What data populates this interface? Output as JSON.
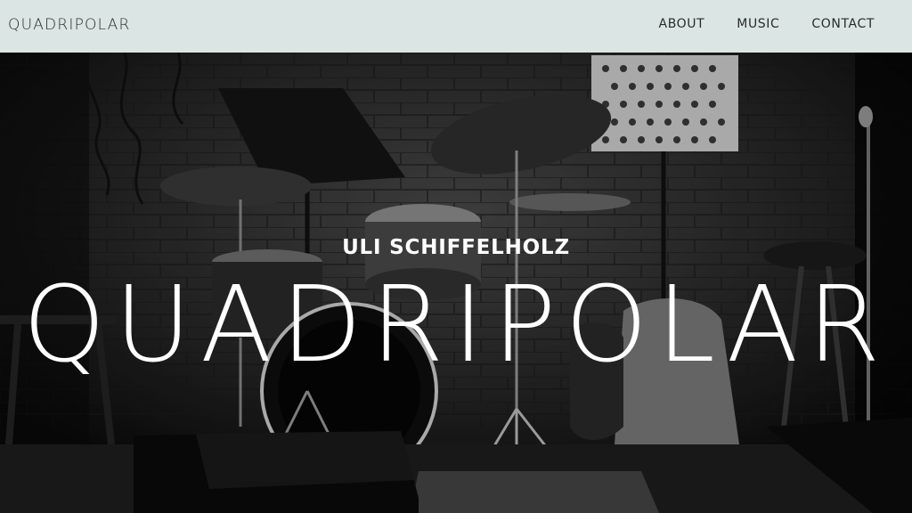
{
  "header": {
    "brand": "QUADRIPOLAR",
    "nav": [
      {
        "label": "ABOUT"
      },
      {
        "label": "MUSIC"
      },
      {
        "label": "CONTACT"
      }
    ]
  },
  "hero": {
    "subtitle": "ULI SCHIFFELHOLZ",
    "title": "QUADRIPOLAR",
    "background": "black-and-white photo of drum kit on stage"
  }
}
